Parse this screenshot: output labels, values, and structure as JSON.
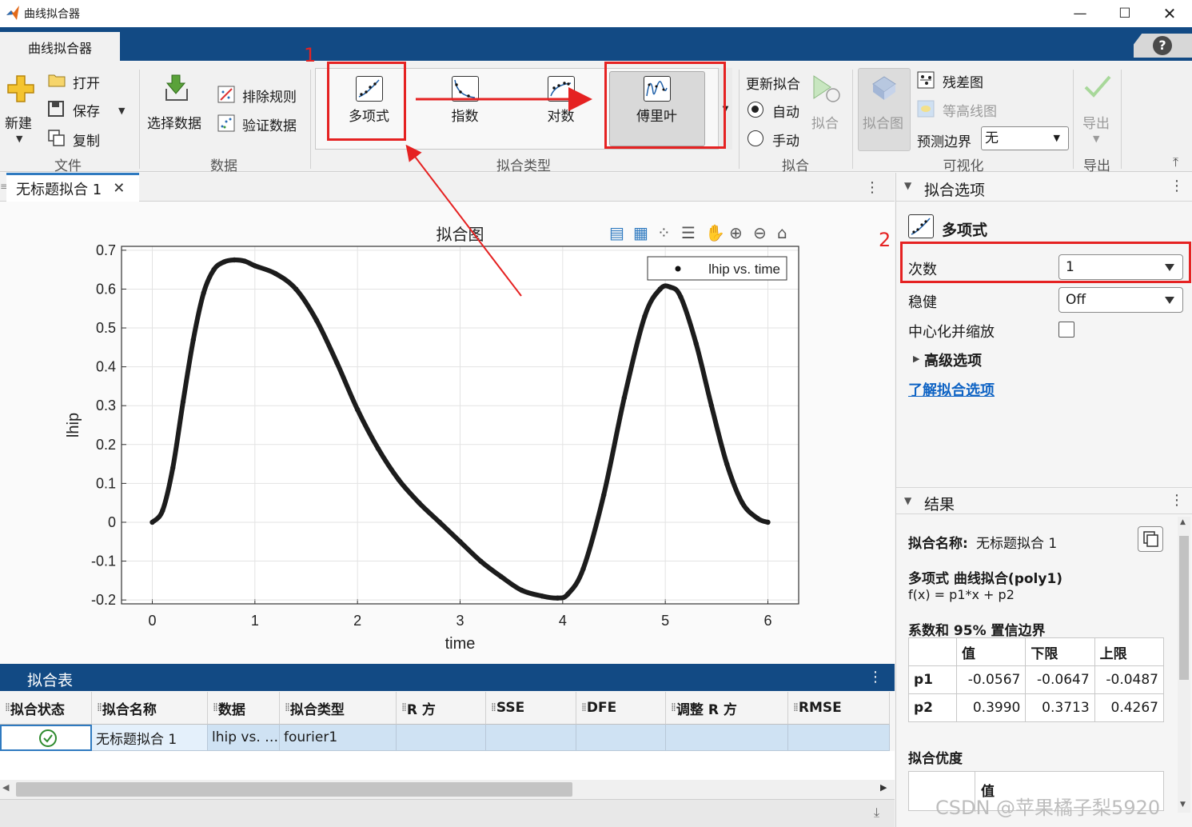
{
  "window": {
    "title": "曲线拟合器"
  },
  "app_tab": {
    "label": "曲线拟合器"
  },
  "toolstrip": {
    "file": {
      "new_label": "新建",
      "open_label": "打开",
      "save_label": "保存",
      "copy_label": "复制",
      "section": "文件"
    },
    "data": {
      "select_label": "选择数据",
      "exclude_label": "排除规则",
      "validate_label": "验证数据",
      "section": "数据"
    },
    "fit_type": {
      "items": [
        "多项式",
        "指数",
        "对数",
        "傅里叶"
      ],
      "section": "拟合类型"
    },
    "fit": {
      "update_label": "更新拟合",
      "auto_label": "自动",
      "manual_label": "手动",
      "fit_button": "拟合",
      "section": "拟合"
    },
    "visualize": {
      "fit_plot": "拟合图",
      "residual": "残差图",
      "contour": "等高线图",
      "bounds_label": "预测边界",
      "bounds_value": "无",
      "section": "可视化"
    },
    "export": {
      "label": "导出",
      "section": "导出"
    }
  },
  "annotations": {
    "marker_1": "1",
    "marker_2": "2",
    "accent": "#e52222"
  },
  "document_tab": {
    "label": "无标题拟合 1"
  },
  "chart_data": {
    "type": "line",
    "title": "拟合图",
    "xlabel": "time",
    "ylabel": "lhip",
    "xlim": [
      -0.3,
      6.3
    ],
    "ylim": [
      -0.21,
      0.71
    ],
    "xticks": [
      "0",
      "1",
      "2",
      "3",
      "4",
      "5",
      "6"
    ],
    "yticks": [
      "0.7",
      "0.6",
      "0.5",
      "0.4",
      "0.3",
      "0.2",
      "0.1",
      "0",
      "-0.1",
      "-0.2"
    ],
    "grid": true,
    "legend": {
      "entries": [
        "lhip vs. time"
      ],
      "position": "top-right"
    },
    "series": [
      {
        "name": "lhip vs. time",
        "x": [
          0,
          0.1,
          0.2,
          0.3,
          0.4,
          0.5,
          0.6,
          0.7,
          0.8,
          0.9,
          1.0,
          1.2,
          1.4,
          1.6,
          1.8,
          2.0,
          2.2,
          2.4,
          2.6,
          2.8,
          3.0,
          3.2,
          3.4,
          3.6,
          3.8,
          3.95,
          4.05,
          4.2,
          4.4,
          4.6,
          4.8,
          4.95,
          5.05,
          5.15,
          5.3,
          5.45,
          5.6,
          5.75,
          5.9,
          6.0
        ],
        "y": [
          0,
          0.03,
          0.14,
          0.31,
          0.47,
          0.59,
          0.65,
          0.67,
          0.675,
          0.672,
          0.66,
          0.64,
          0.6,
          0.52,
          0.41,
          0.29,
          0.19,
          0.11,
          0.05,
          0.0,
          -0.05,
          -0.1,
          -0.14,
          -0.175,
          -0.19,
          -0.195,
          -0.185,
          -0.12,
          0.07,
          0.32,
          0.53,
          0.6,
          0.605,
          0.58,
          0.46,
          0.3,
          0.15,
          0.05,
          0.01,
          0.0
        ]
      }
    ]
  },
  "plot_toolbar": {
    "icons": [
      "legend-icon",
      "grid-icon",
      "brush-icon",
      "datatip-icon",
      "pan-icon",
      "zoom-in-icon",
      "zoom-out-icon",
      "home-icon"
    ]
  },
  "fit_table": {
    "title": "拟合表",
    "headers": [
      "拟合状态",
      "拟合名称",
      "数据",
      "拟合类型",
      "R 方",
      "SSE",
      "DFE",
      "调整 R 方",
      "RMSE"
    ],
    "rows": [
      {
        "status": "ok",
        "name": "无标题拟合 1",
        "data": "lhip vs. …",
        "type": "fourier1",
        "r2": "",
        "sse": "",
        "dfe": "",
        "adjr2": "",
        "rmse": ""
      }
    ]
  },
  "fit_options": {
    "header": "拟合选项",
    "model": "多项式",
    "degree_label": "次数",
    "degree_value": "1",
    "robust_label": "稳健",
    "robust_value": "Off",
    "center_label": "中心化并缩放",
    "advanced_label": "高级选项",
    "learn_link": "了解拟合选项"
  },
  "results": {
    "header": "结果",
    "fit_name_label": "拟合名称:",
    "fit_name_value": "无标题拟合 1",
    "model_title": "多项式 曲线拟合(poly1)",
    "equation": "f(x) = p1*x + p2",
    "coef_title": "系数和 95% 置信边界",
    "coef_headers": [
      "值",
      "下限",
      "上限"
    ],
    "coefs": [
      {
        "name": "p1",
        "value": "-0.0567",
        "lower": "-0.0647",
        "upper": "-0.0487"
      },
      {
        "name": "p2",
        "value": "0.3990",
        "lower": "0.3713",
        "upper": "0.4267"
      }
    ],
    "gof_title": "拟合优度",
    "gof_header": "值"
  },
  "watermark": "CSDN @苹果橘子梨5920"
}
